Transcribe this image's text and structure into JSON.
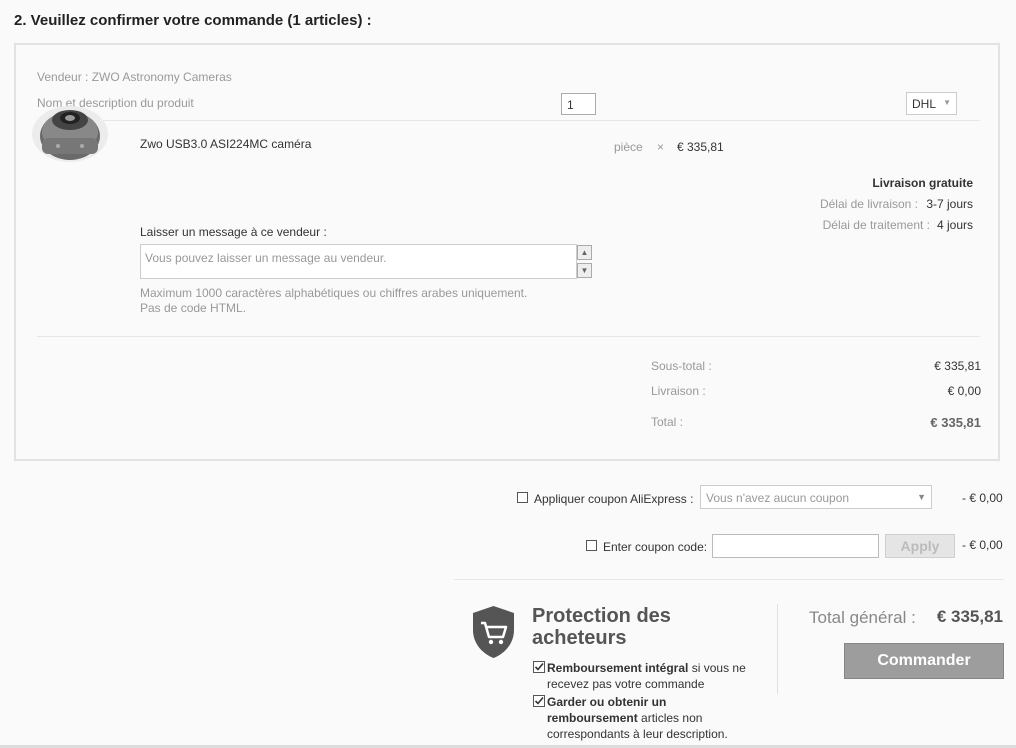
{
  "heading": "2. Veuillez confirmer votre commande (1 articles) :",
  "seller_line": "Vendeur : ZWO Astronomy Cameras",
  "columns_line": "Nom et description du produit",
  "product": {
    "name": "Zwo USB3.0 ASI224MC caméra",
    "quantity": "1",
    "unit": "pièce",
    "times": "×",
    "unit_price": "€ 335,81",
    "shipping_method": "DHL",
    "shipping_free": "Livraison gratuite",
    "delivery_label": "Délai de livraison :",
    "delivery_value": "3-7 jours",
    "processing_label": "Délai de traitement :",
    "processing_value": "4 jours"
  },
  "message": {
    "label": "Laisser un message à ce vendeur :",
    "placeholder": "Vous pouvez laisser un message au vendeur.",
    "hint_line1": "Maximum 1000 caractères alphabétiques ou chiffres arabes uniquement.",
    "hint_line2": "Pas de code HTML."
  },
  "totals": {
    "subtotal_label": "Sous-total :",
    "subtotal_value": "€ 335,81",
    "shipping_label": "Livraison :",
    "shipping_value": "€ 0,00",
    "total_label": "Total :",
    "total_value": "€ 335,81"
  },
  "coupons": {
    "aliexpress_label": "Appliquer coupon AliExpress :",
    "aliexpress_select": "Vous n'avez aucun coupon",
    "aliexpress_discount": "- € 0,00",
    "code_label": "Enter coupon code:",
    "apply_label": "Apply",
    "code_discount": "- € 0,00"
  },
  "protection": {
    "title_line1": "Protection des",
    "title_line2": "acheteurs",
    "item1_bold": "Remboursement intégral",
    "item1_rest": "si vous ne",
    "item1_line2": "recevez pas votre commande",
    "item2_bold1": "Garder ou obtenir un",
    "item2_bold2": "remboursement",
    "item2_rest": "articles non",
    "item2_line3": "correspondants à leur description."
  },
  "grand_total_label": "Total général :",
  "grand_total_value": "€ 335,81",
  "order_button": "Commander",
  "colors": {
    "text": "#333333",
    "muted": "#999999",
    "button": "#9d9d9d"
  }
}
